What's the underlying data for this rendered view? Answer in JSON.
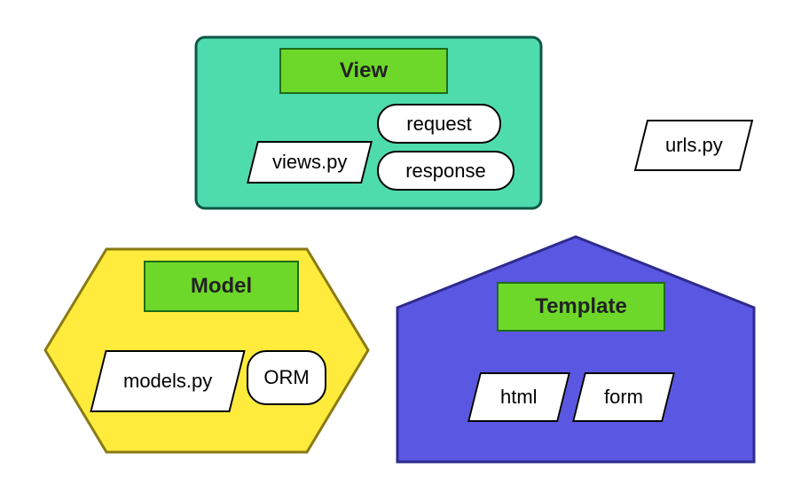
{
  "view": {
    "title": "View",
    "file": "views.py",
    "request": "request",
    "response": "response"
  },
  "urls_file": "urls.py",
  "model": {
    "title": "Model",
    "file": "models.py",
    "orm": "ORM"
  },
  "template": {
    "title": "Template",
    "html": "html",
    "form": "form"
  },
  "colors": {
    "view_bg": "#4EDCAD",
    "model_bg": "#FFEB3B",
    "template_bg": "#5A57E3",
    "title_bg": "#6DD829"
  }
}
